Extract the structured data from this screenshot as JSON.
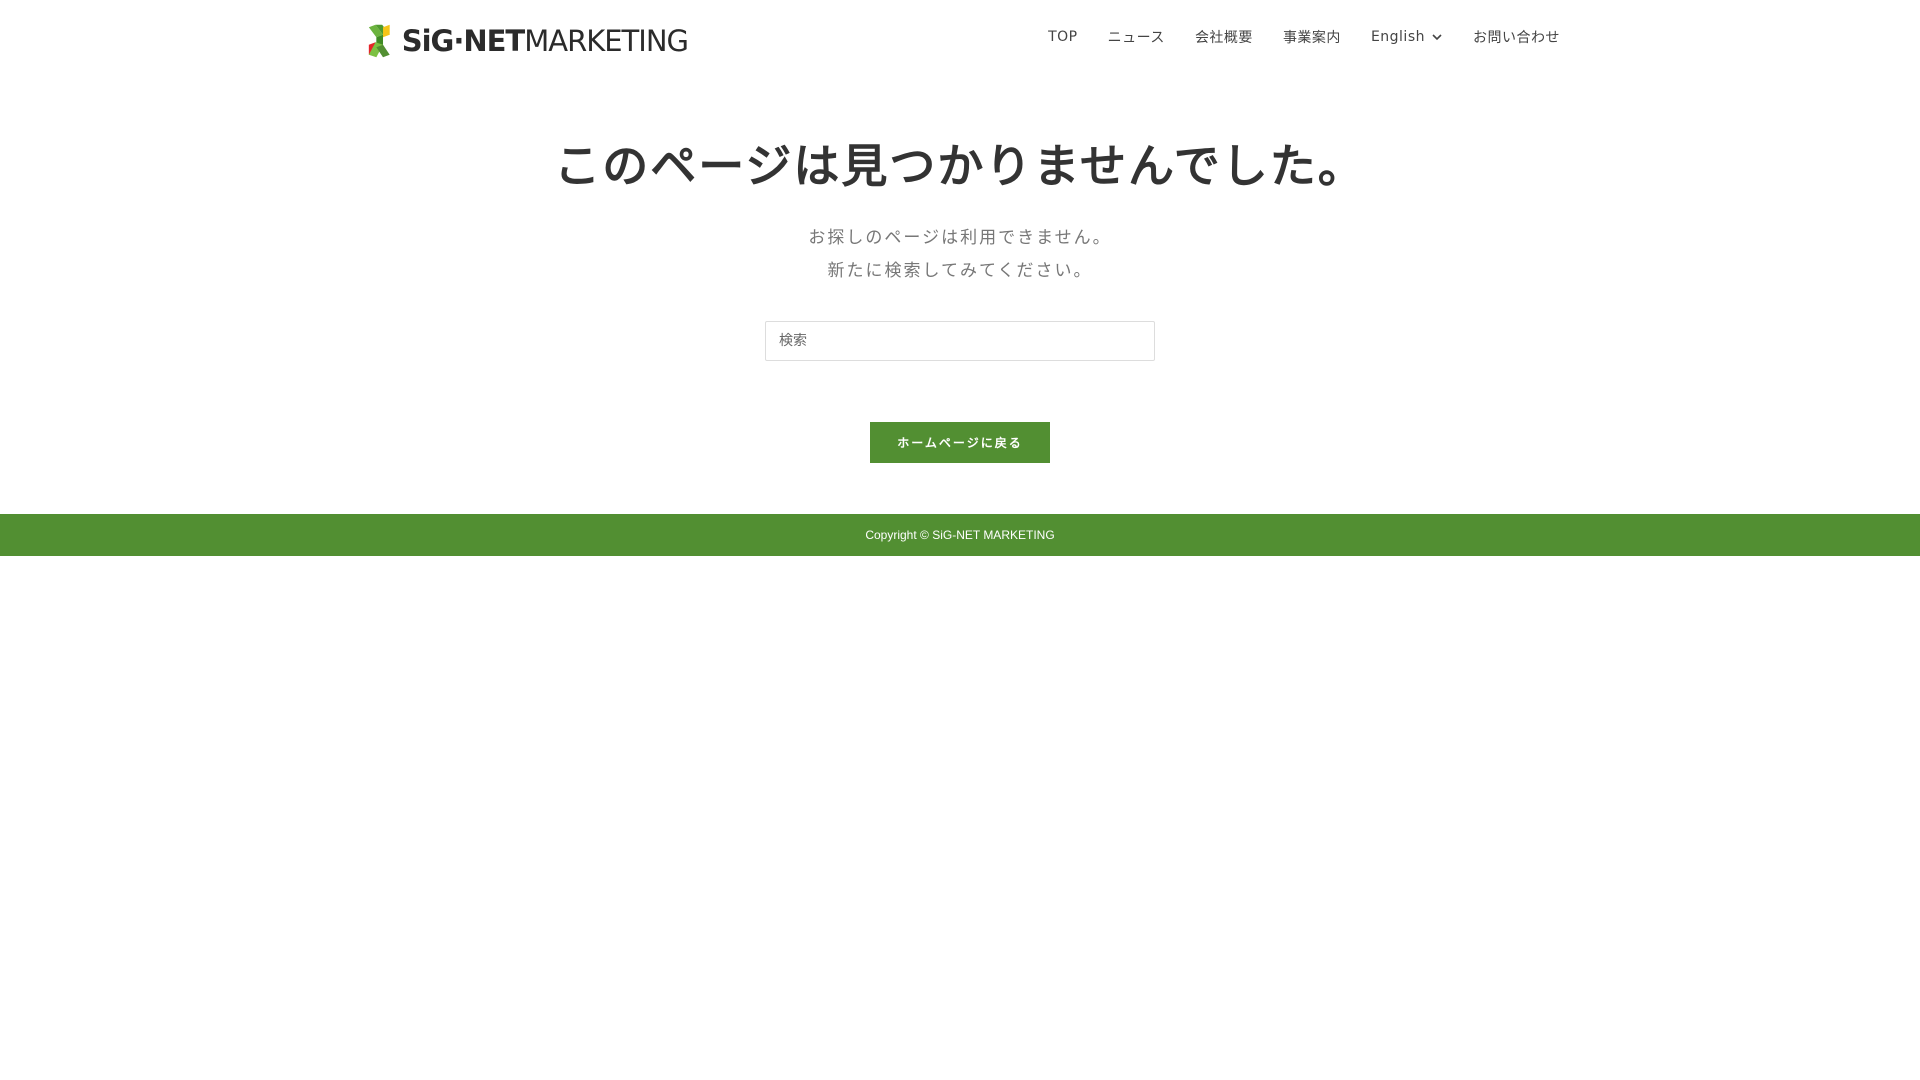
{
  "brand": {
    "name_bold": "SiG·NET",
    "name_light": "MARKETING",
    "colors": {
      "green": "#528f32",
      "light_green": "#7cc142",
      "yellow": "#f5c518",
      "red": "#e5252a"
    }
  },
  "nav": {
    "items": [
      {
        "label": "TOP"
      },
      {
        "label": "ニュース"
      },
      {
        "label": "会社概要"
      },
      {
        "label": "事業案内"
      },
      {
        "label": "English",
        "icon": "chevron-down-icon"
      },
      {
        "label": "お問い合わせ"
      }
    ]
  },
  "main": {
    "title": "このページは見つかりませんでした。",
    "message_line1": "お探しのページは利用できません。",
    "message_line2": "新たに検索してみてください。",
    "search_placeholder": "検索",
    "home_button_label": "ホームページに戻る"
  },
  "footer": {
    "copyright": "Copyright © SiG-NET MARKETING"
  }
}
